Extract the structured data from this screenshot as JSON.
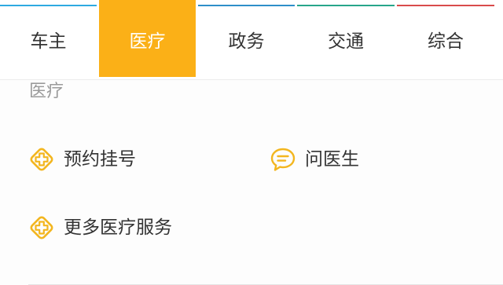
{
  "tabs": [
    {
      "label": "车主",
      "strip_color": "#2eaae1",
      "active": false
    },
    {
      "label": "医疗",
      "strip_color": "#fbb017",
      "active": true
    },
    {
      "label": "政务",
      "strip_color": "#2e8fc9",
      "active": false
    },
    {
      "label": "交通",
      "strip_color": "#27a58a",
      "active": false
    },
    {
      "label": "综合",
      "strip_color": "#d94b4b",
      "active": false
    }
  ],
  "active_color": "#fbb017",
  "section": {
    "title": "医疗",
    "services": [
      {
        "label": "预约挂号",
        "icon": "medical-cross-icon"
      },
      {
        "label": "问医生",
        "icon": "chat-bubble-icon"
      },
      {
        "label": "更多医疗服务",
        "icon": "medical-cross-icon"
      }
    ]
  }
}
